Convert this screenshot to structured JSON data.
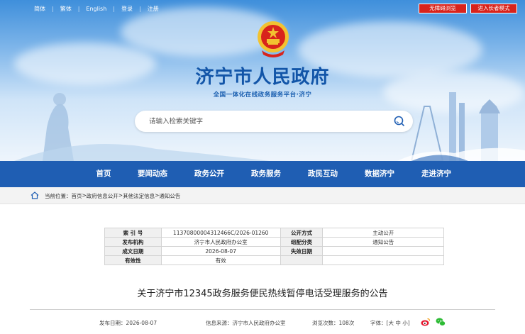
{
  "topbar": {
    "links": [
      "简体",
      "繁体",
      "English",
      "登录",
      "注册"
    ],
    "accessibility_label": "无障碍浏览",
    "elder_mode_label": "进入长者模式"
  },
  "header": {
    "title": "济宁市人民政府",
    "subtitle": "全国一体化在线政务服务平台·济宁"
  },
  "search": {
    "placeholder": "请输入检索关键字",
    "icon": "search-icon"
  },
  "nav": {
    "items": [
      "首页",
      "要闻动态",
      "政务公开",
      "政务服务",
      "政民互动",
      "数据济宁",
      "走进济宁"
    ]
  },
  "breadcrumb": {
    "prefix": "当前位置：",
    "items": [
      "首页",
      "政府信息公开",
      "其他法定信息",
      "通知公告"
    ],
    "separator": " > "
  },
  "info_table": {
    "index_label": "索 引 号",
    "index_value": "11370800004312466C/2026-01260",
    "open_method_label": "公开方式",
    "open_method_value": "主动公开",
    "publisher_label": "发布机构",
    "publisher_value": "济宁市人民政府办公室",
    "category_label": "组配分类",
    "category_value": "通知公告",
    "date_label": "成文日期",
    "date_value": "2026-08-07",
    "expire_label": "失效日期",
    "expire_value": "",
    "validity_label": "有效性",
    "validity_value": "有效"
  },
  "article": {
    "title": "关于济宁市12345政务服务便民热线暂停电话受理服务的公告",
    "publish_date_label": "发布日期：",
    "publish_date": "2026-08-07",
    "source_label": "信息来源：",
    "source": "济宁市人民政府办公室",
    "views_label": "浏览次数：",
    "views": "108次",
    "font_label": "字体：",
    "font_bracket_open": "[",
    "font_large": "大",
    "font_medium": "中",
    "font_small": "小",
    "font_bracket_close": "]"
  },
  "colors": {
    "nav_blue": "#1f5eb3",
    "title_blue": "#1255a8",
    "button_red": "#d8231c"
  }
}
